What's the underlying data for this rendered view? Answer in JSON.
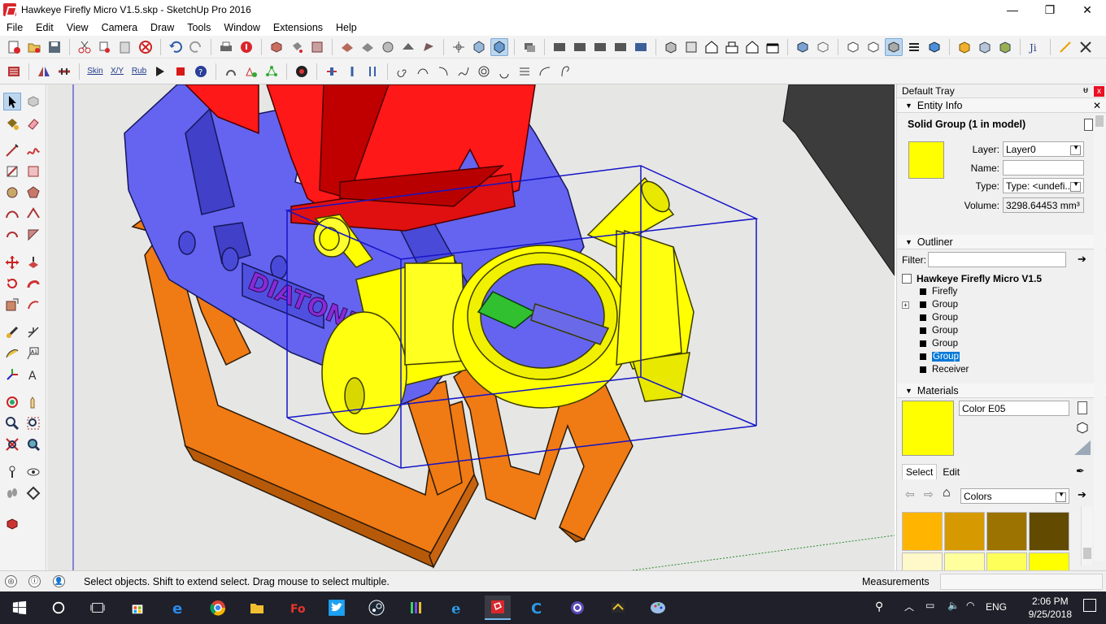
{
  "window": {
    "title": "Hawkeye Firefly Micro V1.5.skp - SketchUp Pro 2016",
    "minimize": "—",
    "maximize": "❐",
    "close": "✕"
  },
  "menu": [
    "File",
    "Edit",
    "View",
    "Camera",
    "Draw",
    "Tools",
    "Window",
    "Extensions",
    "Help"
  ],
  "toolbar2_text_buttons": [
    "Skin",
    "X/Y",
    "Rub"
  ],
  "tray": {
    "title": "Default Tray",
    "pin": "ᵾ",
    "close": "x",
    "entity_info": {
      "header": "Entity Info",
      "selection": "Solid Group (1 in model)",
      "layer_label": "Layer:",
      "layer_value": "Layer0",
      "name_label": "Name:",
      "name_value": "",
      "type_label": "Type:",
      "type_value": "Type: <undefi...",
      "volume_label": "Volume:",
      "volume_value": "3298.64453 mm³",
      "swatch_color": "#ffff00"
    },
    "outliner": {
      "header": "Outliner",
      "filter_label": "Filter:",
      "filter_value": "",
      "root": "Hawkeye Firefly Micro V1.5",
      "items": [
        {
          "label": "Firefly",
          "selected": false,
          "expandable": false
        },
        {
          "label": "Group",
          "selected": false,
          "expandable": true
        },
        {
          "label": "Group",
          "selected": false,
          "expandable": false
        },
        {
          "label": "Group",
          "selected": false,
          "expandable": false
        },
        {
          "label": "Group",
          "selected": false,
          "expandable": false
        },
        {
          "label": "Group",
          "selected": true,
          "expandable": false
        },
        {
          "label": "Receiver",
          "selected": false,
          "expandable": false
        }
      ]
    },
    "materials": {
      "header": "Materials",
      "name_value": "Color E05",
      "swatch_color": "#ffff00",
      "tab_select": "Select",
      "tab_edit": "Edit",
      "library_value": "Colors",
      "colors": [
        "#ffb400",
        "#d69a00",
        "#9c7200",
        "#624a00",
        "#fff8c8",
        "#ffff9e",
        "#ffff5a",
        "#ffff00"
      ]
    }
  },
  "status": {
    "message": "Select objects. Shift to extend select. Drag mouse to select multiple.",
    "measurements_label": "Measurements",
    "measurements_value": ""
  },
  "taskbar": {
    "lang": "ENG",
    "time": "2:06 PM",
    "date": "9/25/2018"
  },
  "colors": {
    "selection_box": "#1414c8",
    "red_part": "#ff1818",
    "blue_part": "#6464f0",
    "orange_part": "#f07a14",
    "yellow_part": "#ffff00"
  }
}
